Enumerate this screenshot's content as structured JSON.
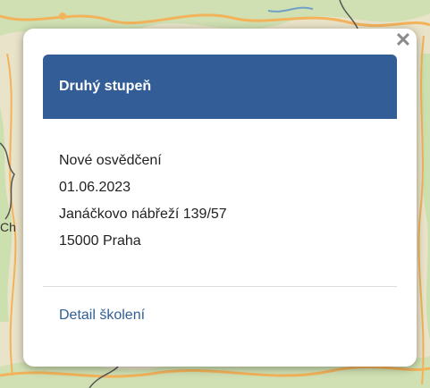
{
  "popup": {
    "close_symbol": "✕",
    "title": "Druhý stupeň",
    "lines": [
      "Nové osvědčení",
      "01.06.2023",
      "Janáčkovo nábřeží 139/57",
      "15000 Praha"
    ],
    "link_label": "Detail školení"
  },
  "map": {
    "visible_fragment": "Ch"
  },
  "colors": {
    "header": "#325d96",
    "link": "#2f5f95",
    "map_land": "#e9e3c9",
    "map_forest": "#c9dfac",
    "map_road": "#f3b35b",
    "map_border": "#555555"
  }
}
